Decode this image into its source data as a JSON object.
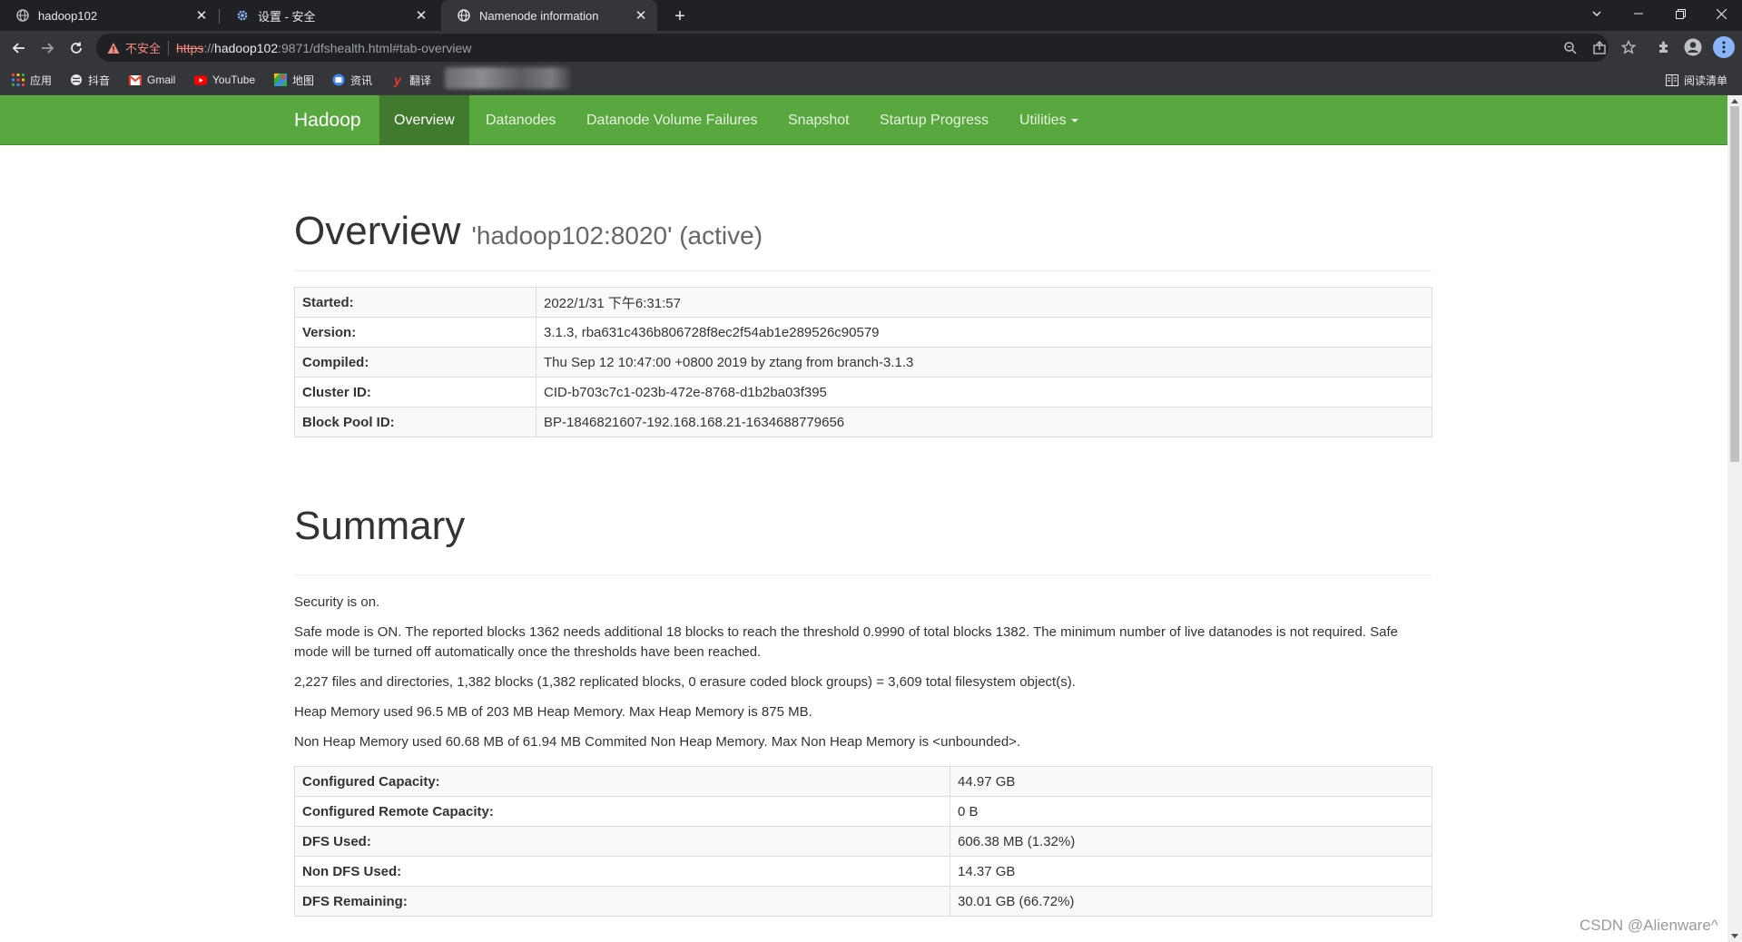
{
  "browser": {
    "tabs": [
      {
        "title": "hadoop102",
        "icon": "globe-icon",
        "active": false
      },
      {
        "title": "设置 - 安全",
        "icon": "gear-icon",
        "active": false
      },
      {
        "title": "Namenode information",
        "icon": "globe-icon",
        "active": true
      }
    ],
    "address": {
      "warning": "不安全",
      "scheme": "https",
      "host_sep": "://",
      "host": "hadoop102",
      "rest": ":9871/dfshealth.html#tab-overview"
    },
    "bookmarks": [
      {
        "label": "应用",
        "icon": "apps-grid-icon"
      },
      {
        "label": "抖音",
        "icon": "globe-icon"
      },
      {
        "label": "Gmail",
        "icon": "gmail-icon"
      },
      {
        "label": "YouTube",
        "icon": "youtube-icon"
      },
      {
        "label": "地图",
        "icon": "maps-icon"
      },
      {
        "label": "资讯",
        "icon": "news-icon"
      },
      {
        "label": "翻译",
        "icon": "translate-icon"
      }
    ],
    "reading_list": "阅读清单"
  },
  "navbar": {
    "brand": "Hadoop",
    "items": [
      "Overview",
      "Datanodes",
      "Datanode Volume Failures",
      "Snapshot",
      "Startup Progress",
      "Utilities"
    ],
    "active_item": "Overview"
  },
  "overview": {
    "title": "Overview",
    "subtitle": "'hadoop102:8020' (active)",
    "rows": [
      {
        "key": "Started:",
        "value": "2022/1/31 下午6:31:57"
      },
      {
        "key": "Version:",
        "value": "3.1.3, rba631c436b806728f8ec2f54ab1e289526c90579"
      },
      {
        "key": "Compiled:",
        "value": "Thu Sep 12 10:47:00 +0800 2019 by ztang from branch-3.1.3"
      },
      {
        "key": "Cluster ID:",
        "value": "CID-b703c7c1-023b-472e-8768-d1b2ba03f395"
      },
      {
        "key": "Block Pool ID:",
        "value": "BP-1846821607-192.168.168.21-1634688779656"
      }
    ]
  },
  "summary": {
    "title": "Summary",
    "lines": [
      "Security is on.",
      "Safe mode is ON. The reported blocks 1362 needs additional 18 blocks to reach the threshold 0.9990 of total blocks 1382. The minimum number of live datanodes is not required. Safe mode will be turned off automatically once the thresholds have been reached.",
      "2,227 files and directories, 1,382 blocks (1,382 replicated blocks, 0 erasure coded block groups) = 3,609 total filesystem object(s).",
      "Heap Memory used 96.5 MB of 203 MB Heap Memory. Max Heap Memory is 875 MB.",
      "Non Heap Memory used 60.68 MB of 61.94 MB Commited Non Heap Memory. Max Non Heap Memory is <unbounded>."
    ],
    "rows": [
      {
        "key": "Configured Capacity:",
        "value": "44.97 GB"
      },
      {
        "key": "Configured Remote Capacity:",
        "value": "0 B"
      },
      {
        "key": "DFS Used:",
        "value": "606.38 MB (1.32%)"
      },
      {
        "key": "Non DFS Used:",
        "value": "14.37 GB"
      },
      {
        "key": "DFS Remaining:",
        "value": "30.01 GB (66.72%)"
      }
    ]
  },
  "watermark": "CSDN @Alienware^",
  "colors": {
    "navbar": "#58a73f",
    "navbar_active": "#3f7a2d",
    "chrome_dark": "#202124",
    "chrome_toolbar": "#35363a",
    "warning": "#f28b82"
  }
}
